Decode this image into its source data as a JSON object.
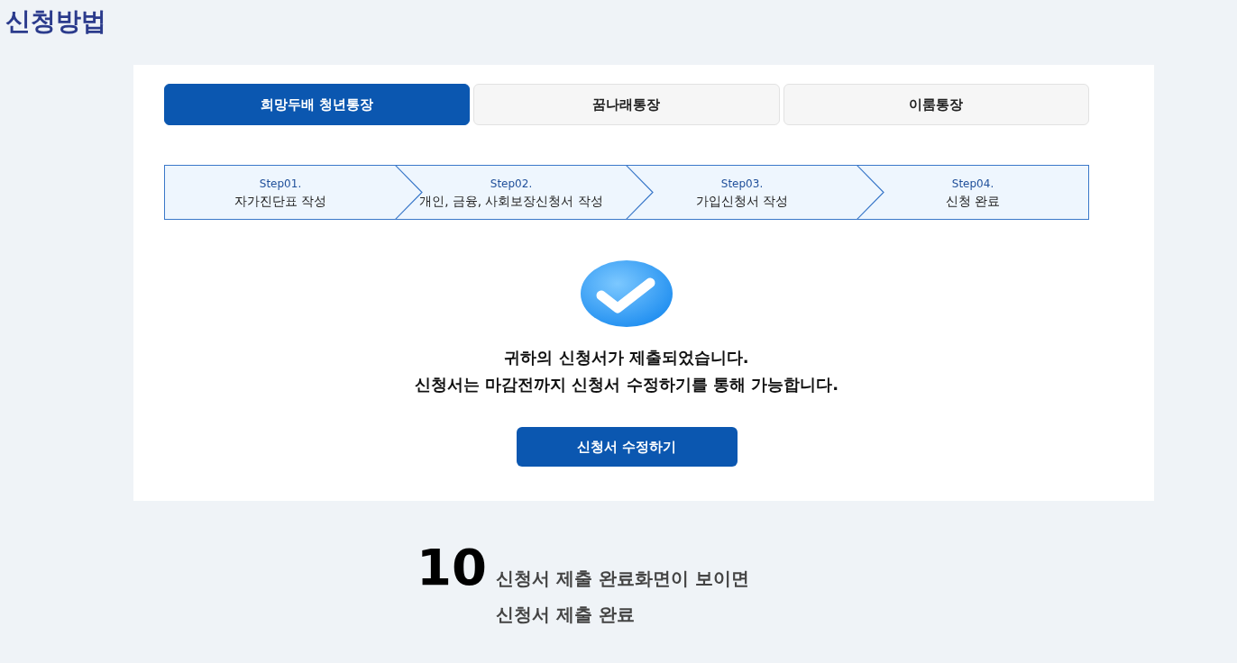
{
  "page_title": "신청방법",
  "tabs": [
    {
      "label": "희망두배 청년통장",
      "selected": true
    },
    {
      "label": "꿈나래통장",
      "selected": false
    },
    {
      "label": "이룸통장",
      "selected": false
    }
  ],
  "steps": [
    {
      "number": "Step01.",
      "label": "자가진단표 작성"
    },
    {
      "number": "Step02.",
      "label": "개인, 금융, 사회보장신청서 작성"
    },
    {
      "number": "Step03.",
      "label": "가입신청서 작성"
    },
    {
      "number": "Step04.",
      "label": "신청 완료"
    }
  ],
  "message": [
    "귀하의 신청서가 제출되었습니다.",
    "신청서는 마감전까지 신청서 수정하기를 통해 가능합니다."
  ],
  "edit_button": "신청서 수정하기",
  "instruction": {
    "number": "10",
    "lines": [
      "신청서 제출 완료화면이 보이면",
      "신청서 제출 완료"
    ]
  }
}
